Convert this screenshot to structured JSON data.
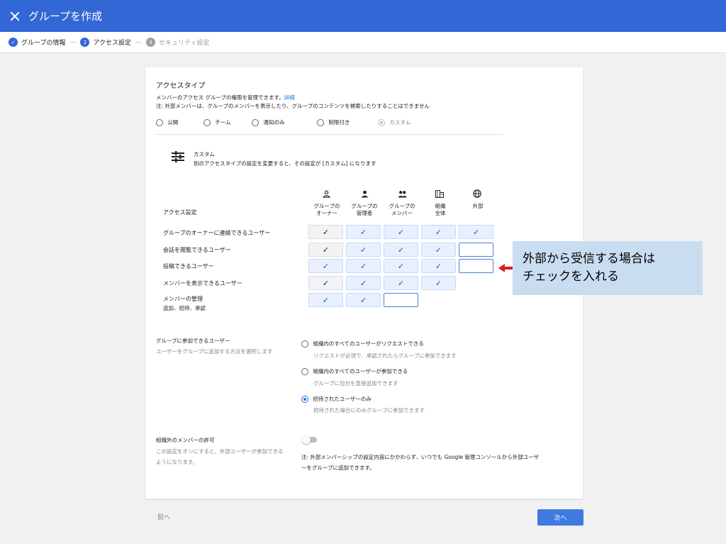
{
  "header": {
    "title": "グループを作成"
  },
  "stepper": {
    "steps": [
      {
        "num": "✓",
        "label": "グループの情報"
      },
      {
        "num": "2",
        "label": "アクセス設定"
      },
      {
        "num": "3",
        "label": "セキュリティ設定"
      }
    ],
    "separator": "—"
  },
  "access_type": {
    "title": "アクセスタイプ",
    "desc": "メンバーのアクセス グループの権限を管理できます。",
    "desc_link": "詳細",
    "note": "注: 外部メンバーは、グループのメンバーを表示したり、グループのコンテンツを検索したりすることはできません",
    "options": [
      "公開",
      "チーム",
      "通知のみ",
      "制限付き",
      "カスタム"
    ],
    "selected": "カスタム"
  },
  "custom": {
    "title": "カスタム",
    "desc": "別のアクセスタイプの設定を変更すると、その設定が [カスタム] になります"
  },
  "table": {
    "header_label": "アクセス設定",
    "columns": [
      {
        "icon": "person-outline-icon",
        "line1": "グループの",
        "line2": "オーナー"
      },
      {
        "icon": "person-icon",
        "line1": "グループの",
        "line2": "管理者"
      },
      {
        "icon": "people-icon",
        "line1": "グループの",
        "line2": "メンバー"
      },
      {
        "icon": "building-icon",
        "line1": "組織",
        "line2": "全体"
      },
      {
        "icon": "globe-icon",
        "line1": "外部",
        "line2": ""
      }
    ],
    "rows": [
      {
        "label": "グループのオーナーに連絡できるユーザー",
        "sub": "",
        "cells": [
          "owner",
          "check",
          "check",
          "check",
          "check"
        ]
      },
      {
        "label": "会話を閲覧できるユーザー",
        "sub": "",
        "cells": [
          "owner",
          "check",
          "check",
          "check",
          "empty"
        ]
      },
      {
        "label": "投稿できるユーザー",
        "sub": "",
        "cells": [
          "check",
          "check",
          "check",
          "check",
          "empty"
        ]
      },
      {
        "label": "メンバーを表示できるユーザー",
        "sub": "",
        "cells": [
          "owner",
          "check",
          "check",
          "check",
          "none"
        ]
      },
      {
        "label": "メンバーの管理",
        "sub": "追加、招待、承認",
        "cells": [
          "check",
          "check",
          "empty",
          "none",
          "none"
        ]
      }
    ],
    "check_glyph": "✓"
  },
  "callout": {
    "line1": "外部から受信する場合は",
    "line2": "チェックを入れる"
  },
  "join": {
    "title": "グループに参加できるユーザー",
    "desc": "ユーザーをグループに追加する方法を選択します",
    "options": [
      {
        "label": "組織内のすべてのユーザーがリクエストできる",
        "sub": "リクエストが必須で、承認されたらグループに参加できます",
        "checked": false
      },
      {
        "label": "組織内のすべてのユーザーが参加できる",
        "sub": "グループに自分を直接追加できます",
        "checked": false
      },
      {
        "label": "招待されたユーザーのみ",
        "sub": "招待された場合にのみグループに参加できます",
        "checked": true
      }
    ]
  },
  "external": {
    "title": "組織外のメンバーの許可",
    "desc1": "この設定をオンにすると、外部ユーザーが参加できる",
    "desc2": "ようになります。",
    "toggle_on": false,
    "note1": "注: 外部メンバーシップの設定内容にかかわらず、いつでも Google 管理コンソールから外部ユーザ",
    "note2": "ーをグループに追加できます。"
  },
  "footer": {
    "prev": "前へ",
    "next": "次へ"
  },
  "colors": {
    "header": "#3367d6",
    "accent": "#1a73e8",
    "arrow": "#d81e1e",
    "callout": "#c9ddf1"
  }
}
